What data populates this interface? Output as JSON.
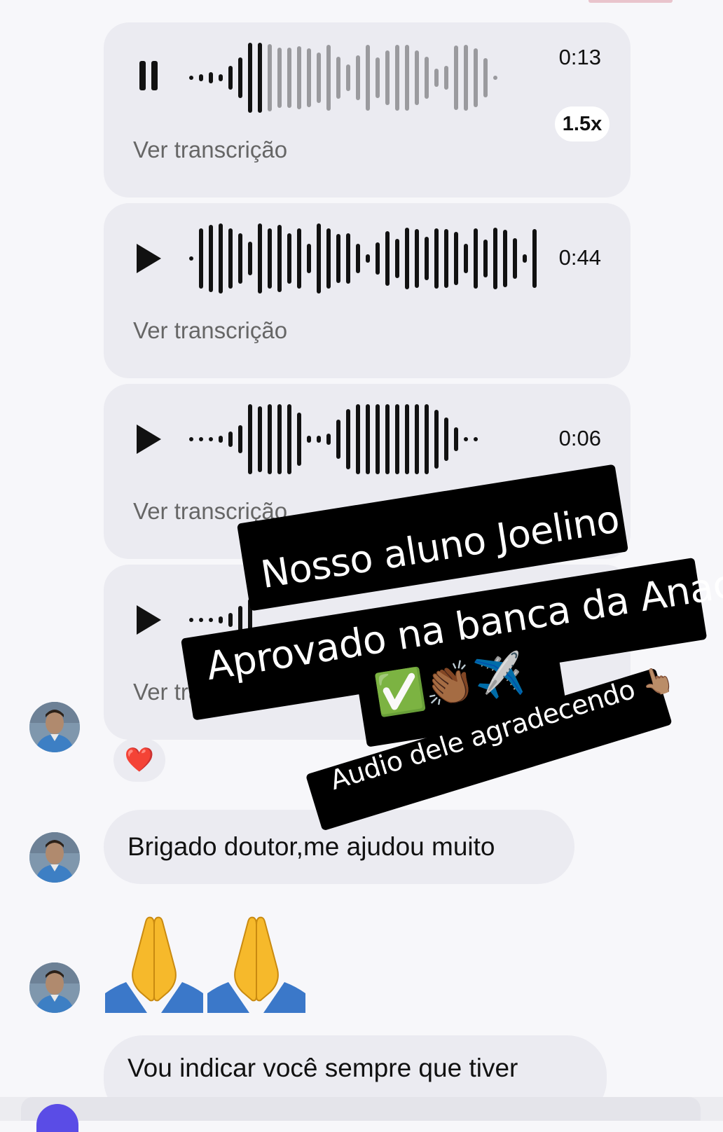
{
  "messages": {
    "voice_notes": [
      {
        "state": "playing",
        "duration": "0:13",
        "speed": "1.5x",
        "transcript_link": "Ver transcrição"
      },
      {
        "state": "paused",
        "duration": "0:44",
        "transcript_link": "Ver transcrição"
      },
      {
        "state": "paused",
        "duration": "0:06",
        "transcript_link": "Ver transcrição"
      },
      {
        "state": "paused",
        "transcript_link": "Ver transcrição"
      }
    ],
    "reaction": "❤️",
    "text_1": "Brigado doutor,me ajudou muito",
    "text_3": "Vou indicar você sempre que tiver"
  },
  "overlay": {
    "line_1": "Nosso aluno Joelino",
    "line_2": "Aprovado na banca da Anac",
    "line_3": "✅👏🏾✈️",
    "caption": "Audio dele agradecendo 👆🏽"
  },
  "colors": {
    "bubble": "#ebebf1",
    "wave_played": "#111111",
    "wave_unplayed": "#9a9a9e",
    "sticker": "#000000"
  },
  "icons": {
    "pause": "pause-icon",
    "play": "play-icon",
    "avatar": "user-avatar",
    "pray": "folded-hands-emoji"
  }
}
